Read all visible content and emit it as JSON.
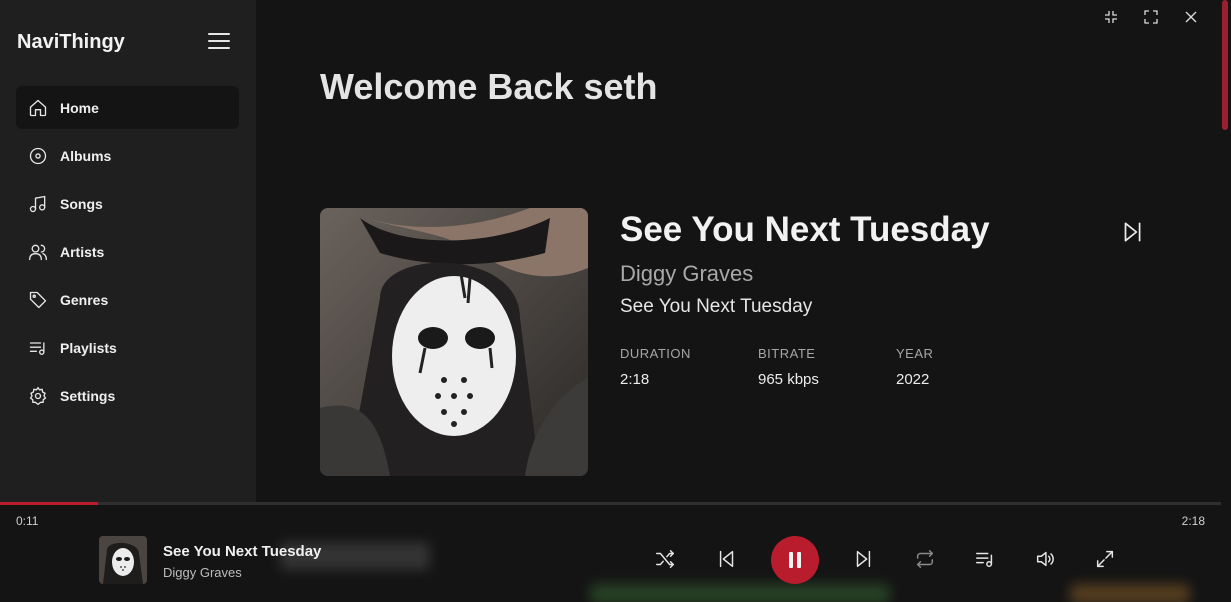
{
  "app": {
    "name": "NaviThingy"
  },
  "nav": [
    {
      "id": "home",
      "label": "Home",
      "icon": "home-icon",
      "active": true
    },
    {
      "id": "albums",
      "label": "Albums",
      "icon": "disc-icon",
      "active": false
    },
    {
      "id": "songs",
      "label": "Songs",
      "icon": "music-note-icon",
      "active": false
    },
    {
      "id": "artists",
      "label": "Artists",
      "icon": "users-icon",
      "active": false
    },
    {
      "id": "genres",
      "label": "Genres",
      "icon": "tag-icon",
      "active": false
    },
    {
      "id": "playlists",
      "label": "Playlists",
      "icon": "playlist-icon",
      "active": false
    },
    {
      "id": "settings",
      "label": "Settings",
      "icon": "gear-icon",
      "active": false
    }
  ],
  "main": {
    "welcome": "Welcome Back seth",
    "now_showing": {
      "title": "See You Next Tuesday",
      "artist": "Diggy Graves",
      "album": "See You Next Tuesday",
      "meta": [
        {
          "key": "DURATION",
          "value": "2:18"
        },
        {
          "key": "BITRATE",
          "value": "965 kbps"
        },
        {
          "key": "YEAR",
          "value": "2022"
        }
      ]
    }
  },
  "player": {
    "current_time": "0:11",
    "total_time": "2:18",
    "progress_fraction": 0.08,
    "title": "See You Next Tuesday",
    "artist": "Diggy Graves"
  },
  "colors": {
    "accent": "#b91c2c",
    "sidebar_bg": "#1f1f1f",
    "main_bg": "#141414"
  }
}
